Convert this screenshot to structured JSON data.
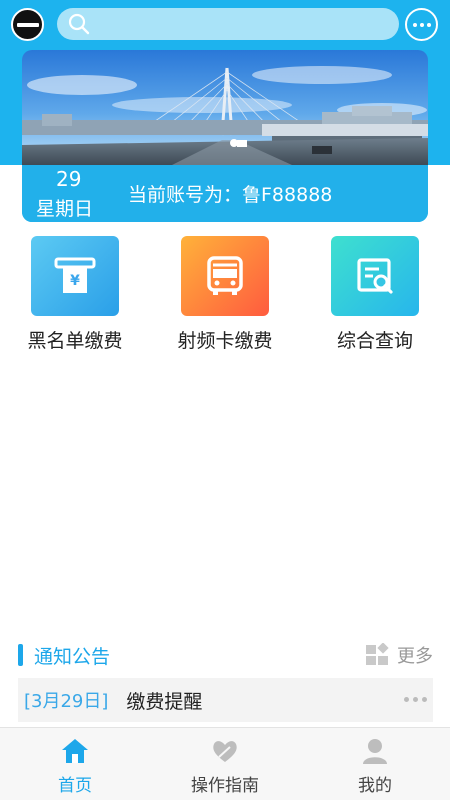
{
  "header": {
    "logo_icon": "app-logo",
    "search": {
      "placeholder": "",
      "icon": "search-icon"
    },
    "message_icon": "chat-bubble-icon"
  },
  "banner": {
    "day": "29",
    "weekday": "星期日",
    "account_text": "当前账号为：鲁F88888",
    "image_icon": "bridge-toll-station-photo"
  },
  "functions": [
    {
      "label": "黑名单缴费",
      "icon": "payment-receipt-icon",
      "color": "#3bb2ee"
    },
    {
      "label": "射频卡缴费",
      "icon": "bus-icon",
      "color": "#ff7a3d"
    },
    {
      "label": "综合查询",
      "icon": "document-search-icon",
      "color": "#30cfe0"
    }
  ],
  "notice": {
    "title": "通知公告",
    "more_label": "更多",
    "more_icon": "grid-squares-icon",
    "items": [
      {
        "date": "[3月29日]",
        "text": "缴费提醒"
      }
    ]
  },
  "tabs": [
    {
      "label": "首页",
      "icon": "home-icon",
      "active": true
    },
    {
      "label": "操作指南",
      "icon": "heart-hands-icon",
      "active": false
    },
    {
      "label": "我的",
      "icon": "user-icon",
      "active": false
    }
  ],
  "colors": {
    "primary": "#1db3ee",
    "accent_text": "#1da7ea"
  }
}
